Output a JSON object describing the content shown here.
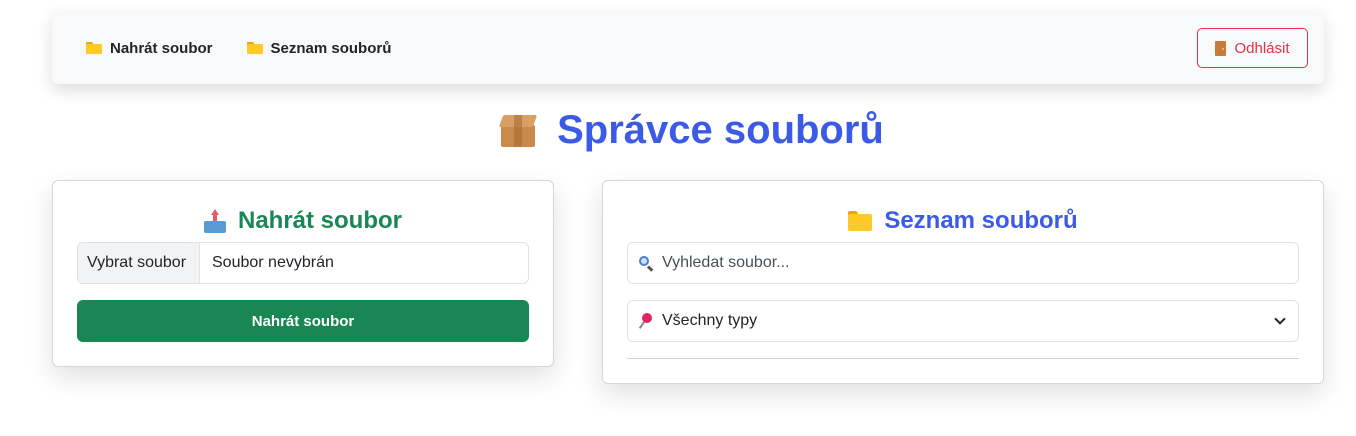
{
  "nav": {
    "links": [
      {
        "label": "Nahrát soubor",
        "icon": "folder-icon"
      },
      {
        "label": "Seznam souborů",
        "icon": "folder-icon"
      }
    ],
    "logout_label": "Odhlásit",
    "logout_icon": "door-icon"
  },
  "page": {
    "title": "Správce souborů",
    "title_icon": "package-icon"
  },
  "upload": {
    "title": "Nahrát soubor",
    "title_icon": "outbox-tray-icon",
    "choose_label": "Vybrat soubor",
    "file_status": "Soubor nevybrán",
    "submit_label": "Nahrát soubor"
  },
  "list": {
    "title": "Seznam souborů",
    "title_icon": "folder-icon",
    "search_placeholder": "Vyhledat soubor...",
    "search_icon": "magnifier-icon",
    "filter_selected": "Všechny typy",
    "filter_icon": "pushpin-icon",
    "files": []
  },
  "colors": {
    "primary": "#3b5be6",
    "success": "#198754",
    "danger": "#dc3545"
  }
}
